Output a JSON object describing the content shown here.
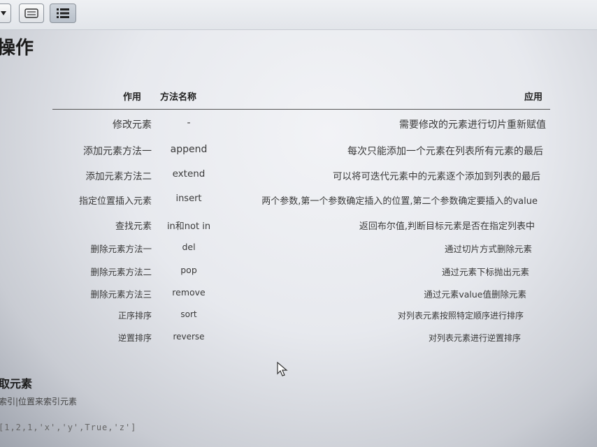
{
  "page": {
    "title": "操作"
  },
  "table": {
    "headers": {
      "role": "作用",
      "method": "方法名称",
      "application": "应用"
    },
    "rows": [
      {
        "role": "修改元素",
        "method": "-",
        "application": "需要修改的元素进行切片重新赋值"
      },
      {
        "role": "添加元素方法一",
        "method": "append",
        "application": "每次只能添加一个元素在列表所有元素的最后"
      },
      {
        "role": "添加元素方法二",
        "method": "extend",
        "application": "可以将可迭代元素中的元素逐个添加到列表的最后"
      },
      {
        "role": "指定位置插入元素",
        "method": "insert",
        "application": "两个参数,第一个参数确定插入的位置,第二个参数确定要插入的value"
      },
      {
        "role": "查找元素",
        "method": "in和not in",
        "application": "返回布尔值,判断目标元素是否在指定列表中"
      },
      {
        "role": "删除元素方法一",
        "method": "del",
        "application": "通过切片方式删除元素"
      },
      {
        "role": "删除元素方法二",
        "method": "pop",
        "application": "通过元素下标抛出元素"
      },
      {
        "role": "删除元素方法三",
        "method": "remove",
        "application": "通过元素value值删除元素"
      },
      {
        "role": "正序排序",
        "method": "sort",
        "application": "对列表元素按照特定顺序进行排序"
      },
      {
        "role": "逆置排序",
        "method": "reverse",
        "application": "对列表元素进行逆置排序"
      }
    ]
  },
  "section": {
    "title": "取元素",
    "description": "索引|位置来索引元素",
    "code": "[1,2,1,'x','y',True,'z']"
  },
  "icons": {
    "toolbar": [
      "dropdown-arrow-icon",
      "keyboard-icon",
      "list-view-icon"
    ],
    "cursor": "mouse-pointer-icon"
  }
}
